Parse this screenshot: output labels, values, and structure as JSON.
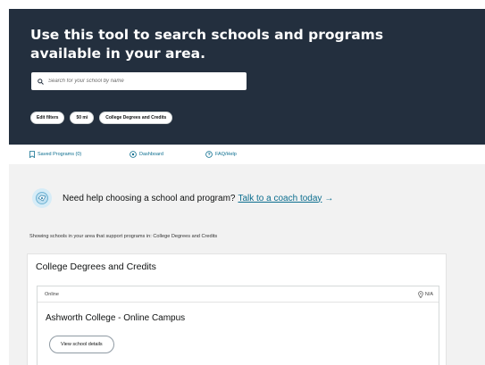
{
  "hero": {
    "title": "Use this tool to search schools and programs available in your area.",
    "search_placeholder": "Search for your school by name",
    "filters": [
      "Edit filters",
      "50 mi",
      "College Degrees and Credits"
    ]
  },
  "nav": {
    "saved": "Saved Programs (0)",
    "dashboard": "Dashboard",
    "faq": "FAQ/Help"
  },
  "help_banner": {
    "text": "Need help choosing a school and program?",
    "link": "Talk to a coach today",
    "arrow": "→"
  },
  "showing_text": "Showing schools in your area that support programs in: College Degrees and Credits",
  "card": {
    "title": "College Degrees and Credits",
    "delivery": "Online",
    "location": "N/A",
    "school_name": "Ashworth College - Online Campus",
    "details_button": "View school details"
  },
  "colors": {
    "hero_bg": "#232f3e",
    "link": "#0c6e8f",
    "page_bg": "#f2f2f2"
  },
  "icons": [
    "search-icon",
    "bookmark-icon",
    "dashboard-icon",
    "help-circle-icon",
    "coach-icon",
    "location-pin-icon"
  ]
}
